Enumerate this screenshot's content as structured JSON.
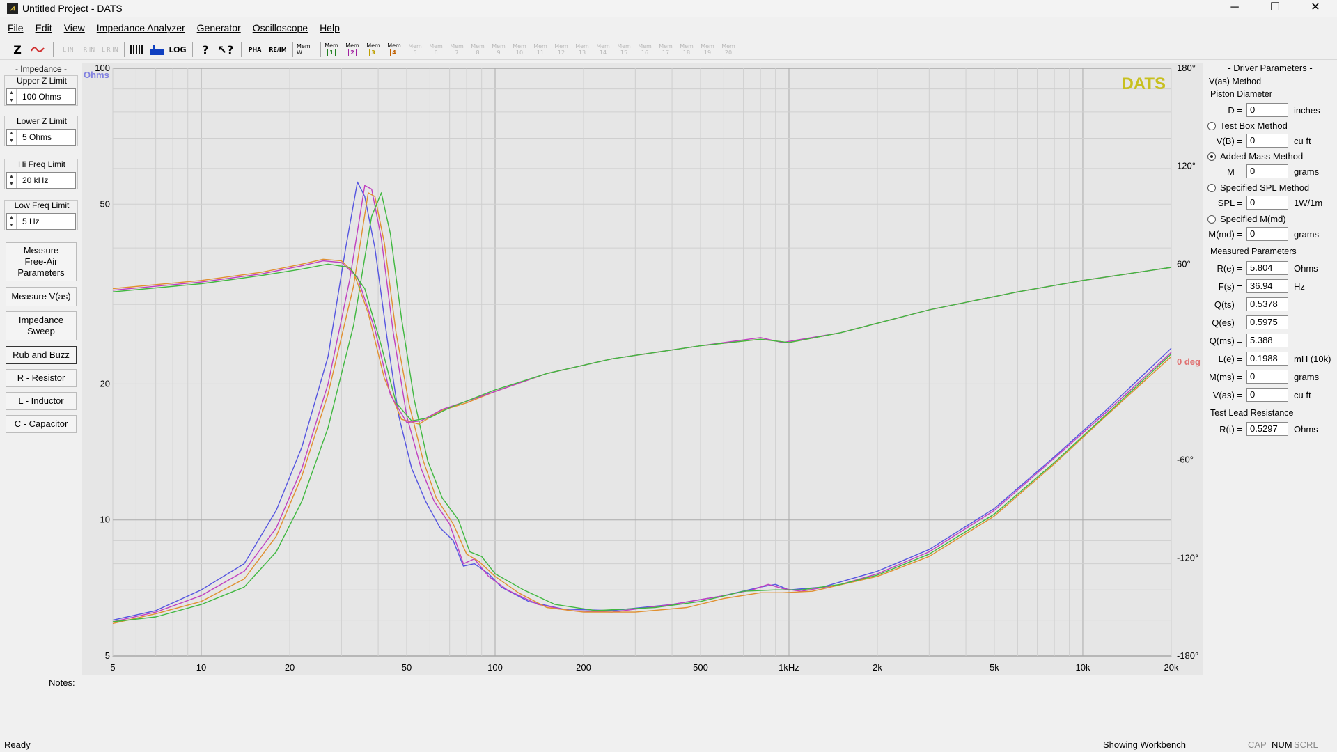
{
  "window": {
    "title": "Untitled Project - DATS",
    "minimize": "─",
    "maximize": "☐",
    "close": "✕"
  },
  "menu": [
    "File",
    "Edit",
    "View",
    "Impedance Analyzer",
    "Generator",
    "Oscilloscope",
    "Help"
  ],
  "toolbar": {
    "z_label": "Z",
    "lin": [
      "L IN",
      "R IN",
      "L R IN"
    ],
    "pha": "PHA",
    "re_im": "RE/IM",
    "mem_w": "Mem W",
    "mem_label": "Mem",
    "mems": [
      "1",
      "2",
      "3",
      "4",
      "5",
      "6",
      "7",
      "8",
      "9",
      "10",
      "11",
      "12",
      "13",
      "14",
      "15",
      "16",
      "17",
      "18",
      "19",
      "20"
    ]
  },
  "left": {
    "impedance_title": "- Impedance -",
    "upper_z_label": "Upper Z Limit",
    "upper_z_value": "100 Ohms",
    "lower_z_label": "Lower Z Limit",
    "lower_z_value": "5 Ohms",
    "hi_freq_label": "Hi Freq Limit",
    "hi_freq_value": "20 kHz",
    "low_freq_label": "Low Freq Limit",
    "low_freq_value": "5 Hz",
    "btn_free_air_1": "Measure",
    "btn_free_air_2": "Free-Air",
    "btn_free_air_3": "Parameters",
    "btn_vas": "Measure V(as)",
    "btn_sweep_1": "Impedance",
    "btn_sweep_2": "Sweep",
    "btn_rub": "Rub and Buzz",
    "btn_r": "R - Resistor",
    "btn_l": "L - Inductor",
    "btn_c": "C - Capacitor"
  },
  "notes_label": "Notes:",
  "right": {
    "title": "- Driver Parameters -",
    "vas_method": "V(as) Method",
    "piston_diameter": "Piston Diameter",
    "d_label": "D =",
    "d_value": "0",
    "d_unit": "inches",
    "test_box": "Test Box Method",
    "vb_label": "V(B) =",
    "vb_value": "0",
    "vb_unit": "cu ft",
    "added_mass": "Added Mass Method",
    "m_label": "M =",
    "m_value": "0",
    "m_unit": "grams",
    "spl_method": "Specified SPL Method",
    "spl_label": "SPL =",
    "spl_value": "0",
    "spl_unit": "1W/1m",
    "mmd_method": "Specified M(md)",
    "mmd_label": "M(md) =",
    "mmd_value": "0",
    "mmd_unit": "grams",
    "measured": "Measured Parameters",
    "params": [
      {
        "label": "R(e) =",
        "value": "5.804",
        "unit": "Ohms"
      },
      {
        "label": "F(s) =",
        "value": "36.94",
        "unit": "Hz"
      },
      {
        "label": "Q(ts) =",
        "value": "0.5378",
        "unit": ""
      },
      {
        "label": "Q(es) =",
        "value": "0.5975",
        "unit": ""
      },
      {
        "label": "Q(ms) =",
        "value": "5.388",
        "unit": ""
      },
      {
        "label": "L(e) =",
        "value": "0.1988",
        "unit": "mH (10k)"
      },
      {
        "label": "M(ms) =",
        "value": "0",
        "unit": "grams"
      },
      {
        "label": "V(as) =",
        "value": "0",
        "unit": "cu ft"
      }
    ],
    "test_lead": "Test Lead Resistance",
    "rt_label": "R(t) =",
    "rt_value": "0.5297",
    "rt_unit": "Ohms"
  },
  "status": {
    "left": "Ready",
    "workbench": "Showing Workbench",
    "cap": "CAP",
    "num": "NUM",
    "scrl": "SCRL"
  },
  "chart_data": {
    "type": "line",
    "watermark": "DATS",
    "y_unit_label": "Ohms",
    "x_scale": "log",
    "y_scale": "log",
    "xlim": [
      5,
      20000
    ],
    "ylim": [
      5,
      100
    ],
    "x_ticks": [
      {
        "v": 5,
        "t": "5"
      },
      {
        "v": 10,
        "t": "10"
      },
      {
        "v": 20,
        "t": "20"
      },
      {
        "v": 50,
        "t": "50"
      },
      {
        "v": 100,
        "t": "100"
      },
      {
        "v": 200,
        "t": "200"
      },
      {
        "v": 500,
        "t": "500"
      },
      {
        "v": 1000,
        "t": "1kHz"
      },
      {
        "v": 2000,
        "t": "2k"
      },
      {
        "v": 5000,
        "t": "5k"
      },
      {
        "v": 10000,
        "t": "10k"
      },
      {
        "v": 20000,
        "t": "20k"
      }
    ],
    "y_ticks": [
      {
        "v": 100,
        "t": "100"
      },
      {
        "v": 50,
        "t": "50"
      },
      {
        "v": 20,
        "t": "20"
      },
      {
        "v": 10,
        "t": "10"
      },
      {
        "v": 5,
        "t": "5"
      }
    ],
    "phase_ticks": [
      {
        "v": 180,
        "t": "180°"
      },
      {
        "v": 120,
        "t": "120°"
      },
      {
        "v": 60,
        "t": "60°"
      },
      {
        "v": 0,
        "t": "0 deg"
      },
      {
        "v": -60,
        "t": "-60°"
      },
      {
        "v": -120,
        "t": "-120°"
      },
      {
        "v": -180,
        "t": "-180°"
      }
    ],
    "phase_lim": [
      -180,
      180
    ],
    "colors": {
      "blue": "#5555e0",
      "orange": "#e09030",
      "green": "#40b840",
      "magenta": "#c040c0",
      "yellow": "#c8c020",
      "phase_zero": "#e07070",
      "axis_label": "#8080e0"
    },
    "impedance_series": [
      {
        "color": "blue",
        "points": [
          [
            5,
            6.0
          ],
          [
            7,
            6.3
          ],
          [
            10,
            7.0
          ],
          [
            14,
            8.0
          ],
          [
            18,
            10.5
          ],
          [
            22,
            14.5
          ],
          [
            27,
            23
          ],
          [
            31,
            40
          ],
          [
            34,
            56
          ],
          [
            36,
            52
          ],
          [
            39,
            40
          ],
          [
            43,
            25
          ],
          [
            47,
            17
          ],
          [
            52,
            13
          ],
          [
            58,
            11
          ],
          [
            65,
            9.6
          ],
          [
            72,
            9.0
          ],
          [
            78,
            7.9
          ],
          [
            85,
            8.0
          ],
          [
            95,
            7.6
          ],
          [
            105,
            7.1
          ],
          [
            130,
            6.6
          ],
          [
            170,
            6.35
          ],
          [
            250,
            6.3
          ],
          [
            400,
            6.5
          ],
          [
            600,
            6.8
          ],
          [
            800,
            7.1
          ],
          [
            900,
            7.2
          ],
          [
            1000,
            7.0
          ],
          [
            1300,
            7.1
          ],
          [
            2000,
            7.7
          ],
          [
            3000,
            8.6
          ],
          [
            5000,
            10.6
          ],
          [
            8000,
            13.8
          ],
          [
            12000,
            17.5
          ],
          [
            20000,
            24
          ]
        ]
      },
      {
        "color": "magenta",
        "points": [
          [
            5,
            5.95
          ],
          [
            7,
            6.25
          ],
          [
            10,
            6.8
          ],
          [
            14,
            7.7
          ],
          [
            18,
            9.6
          ],
          [
            22,
            13
          ],
          [
            27,
            20
          ],
          [
            32,
            34
          ],
          [
            36,
            55
          ],
          [
            38,
            54
          ],
          [
            41,
            42
          ],
          [
            45,
            26
          ],
          [
            50,
            17
          ],
          [
            56,
            13
          ],
          [
            62,
            11
          ],
          [
            70,
            9.8
          ],
          [
            78,
            8.0
          ],
          [
            85,
            8.2
          ],
          [
            95,
            7.5
          ],
          [
            110,
            7.0
          ],
          [
            140,
            6.5
          ],
          [
            180,
            6.3
          ],
          [
            250,
            6.25
          ],
          [
            400,
            6.5
          ],
          [
            600,
            6.8
          ],
          [
            750,
            7.0
          ],
          [
            850,
            7.2
          ],
          [
            950,
            7.05
          ],
          [
            1100,
            6.95
          ],
          [
            1500,
            7.2
          ],
          [
            2000,
            7.6
          ],
          [
            3000,
            8.5
          ],
          [
            5000,
            10.5
          ],
          [
            8000,
            13.7
          ],
          [
            12000,
            17.3
          ],
          [
            20000,
            23.5
          ]
        ]
      },
      {
        "color": "orange",
        "points": [
          [
            5,
            5.9
          ],
          [
            7,
            6.2
          ],
          [
            10,
            6.6
          ],
          [
            14,
            7.4
          ],
          [
            18,
            9.2
          ],
          [
            22,
            12.5
          ],
          [
            27,
            19
          ],
          [
            33,
            33
          ],
          [
            37,
            53
          ],
          [
            39,
            52
          ],
          [
            42,
            41
          ],
          [
            46,
            26
          ],
          [
            51,
            18
          ],
          [
            57,
            13.5
          ],
          [
            63,
            11.2
          ],
          [
            72,
            9.8
          ],
          [
            80,
            8.4
          ],
          [
            88,
            8.1
          ],
          [
            100,
            7.5
          ],
          [
            120,
            6.9
          ],
          [
            150,
            6.4
          ],
          [
            200,
            6.25
          ],
          [
            300,
            6.25
          ],
          [
            450,
            6.4
          ],
          [
            600,
            6.7
          ],
          [
            800,
            6.9
          ],
          [
            950,
            6.9
          ],
          [
            1200,
            6.95
          ],
          [
            2000,
            7.5
          ],
          [
            3000,
            8.3
          ],
          [
            5000,
            10.2
          ],
          [
            8000,
            13.3
          ],
          [
            12000,
            17
          ],
          [
            20000,
            23
          ]
        ]
      },
      {
        "color": "green",
        "points": [
          [
            5,
            5.95
          ],
          [
            7,
            6.1
          ],
          [
            10,
            6.5
          ],
          [
            14,
            7.1
          ],
          [
            18,
            8.5
          ],
          [
            22,
            11
          ],
          [
            27,
            16
          ],
          [
            33,
            27
          ],
          [
            38,
            47
          ],
          [
            41,
            53
          ],
          [
            44,
            43
          ],
          [
            48,
            28
          ],
          [
            53,
            18.5
          ],
          [
            59,
            13.5
          ],
          [
            66,
            11.2
          ],
          [
            75,
            10.0
          ],
          [
            82,
            8.5
          ],
          [
            90,
            8.3
          ],
          [
            100,
            7.6
          ],
          [
            125,
            7.0
          ],
          [
            160,
            6.5
          ],
          [
            220,
            6.3
          ],
          [
            350,
            6.4
          ],
          [
            500,
            6.6
          ],
          [
            700,
            6.95
          ],
          [
            900,
            7.0
          ],
          [
            1100,
            7.0
          ],
          [
            1500,
            7.2
          ],
          [
            2000,
            7.55
          ],
          [
            3000,
            8.4
          ],
          [
            5000,
            10.3
          ],
          [
            8000,
            13.4
          ],
          [
            12000,
            17.1
          ],
          [
            20000,
            23.3
          ]
        ]
      }
    ],
    "phase_series": [
      {
        "color": "orange",
        "points": [
          [
            5,
            45
          ],
          [
            10,
            50
          ],
          [
            16,
            55
          ],
          [
            22,
            60
          ],
          [
            26,
            63
          ],
          [
            30,
            62
          ],
          [
            33,
            55
          ],
          [
            37,
            30
          ],
          [
            42,
            -10
          ],
          [
            48,
            -35
          ],
          [
            55,
            -38
          ],
          [
            65,
            -30
          ],
          [
            80,
            -25
          ],
          [
            100,
            -18
          ],
          [
            150,
            -7
          ],
          [
            250,
            2
          ],
          [
            500,
            10
          ],
          [
            800,
            14
          ],
          [
            1000,
            12
          ],
          [
            1500,
            18
          ],
          [
            3000,
            32
          ],
          [
            6000,
            43
          ],
          [
            10000,
            50
          ],
          [
            20000,
            58
          ]
        ]
      },
      {
        "color": "magenta",
        "points": [
          [
            5,
            44
          ],
          [
            10,
            49
          ],
          [
            16,
            54
          ],
          [
            22,
            59
          ],
          [
            26,
            62
          ],
          [
            30,
            61
          ],
          [
            34,
            52
          ],
          [
            39,
            20
          ],
          [
            44,
            -20
          ],
          [
            50,
            -37
          ],
          [
            56,
            -36
          ],
          [
            66,
            -29
          ],
          [
            80,
            -24
          ],
          [
            100,
            -18
          ],
          [
            150,
            -7
          ],
          [
            250,
            2
          ],
          [
            500,
            10
          ],
          [
            800,
            15
          ],
          [
            950,
            12
          ],
          [
            1500,
            18
          ],
          [
            3000,
            32
          ],
          [
            6000,
            43
          ],
          [
            10000,
            50
          ],
          [
            20000,
            58
          ]
        ]
      },
      {
        "color": "green",
        "points": [
          [
            5,
            43
          ],
          [
            10,
            48
          ],
          [
            16,
            53
          ],
          [
            22,
            57
          ],
          [
            27,
            60
          ],
          [
            32,
            58
          ],
          [
            36,
            45
          ],
          [
            41,
            10
          ],
          [
            46,
            -25
          ],
          [
            52,
            -36
          ],
          [
            60,
            -34
          ],
          [
            70,
            -28
          ],
          [
            85,
            -22
          ],
          [
            100,
            -17
          ],
          [
            150,
            -7
          ],
          [
            250,
            2
          ],
          [
            500,
            10
          ],
          [
            800,
            14
          ],
          [
            1000,
            12
          ],
          [
            1500,
            18
          ],
          [
            3000,
            32
          ],
          [
            6000,
            43
          ],
          [
            10000,
            50
          ],
          [
            20000,
            58
          ]
        ]
      }
    ]
  }
}
